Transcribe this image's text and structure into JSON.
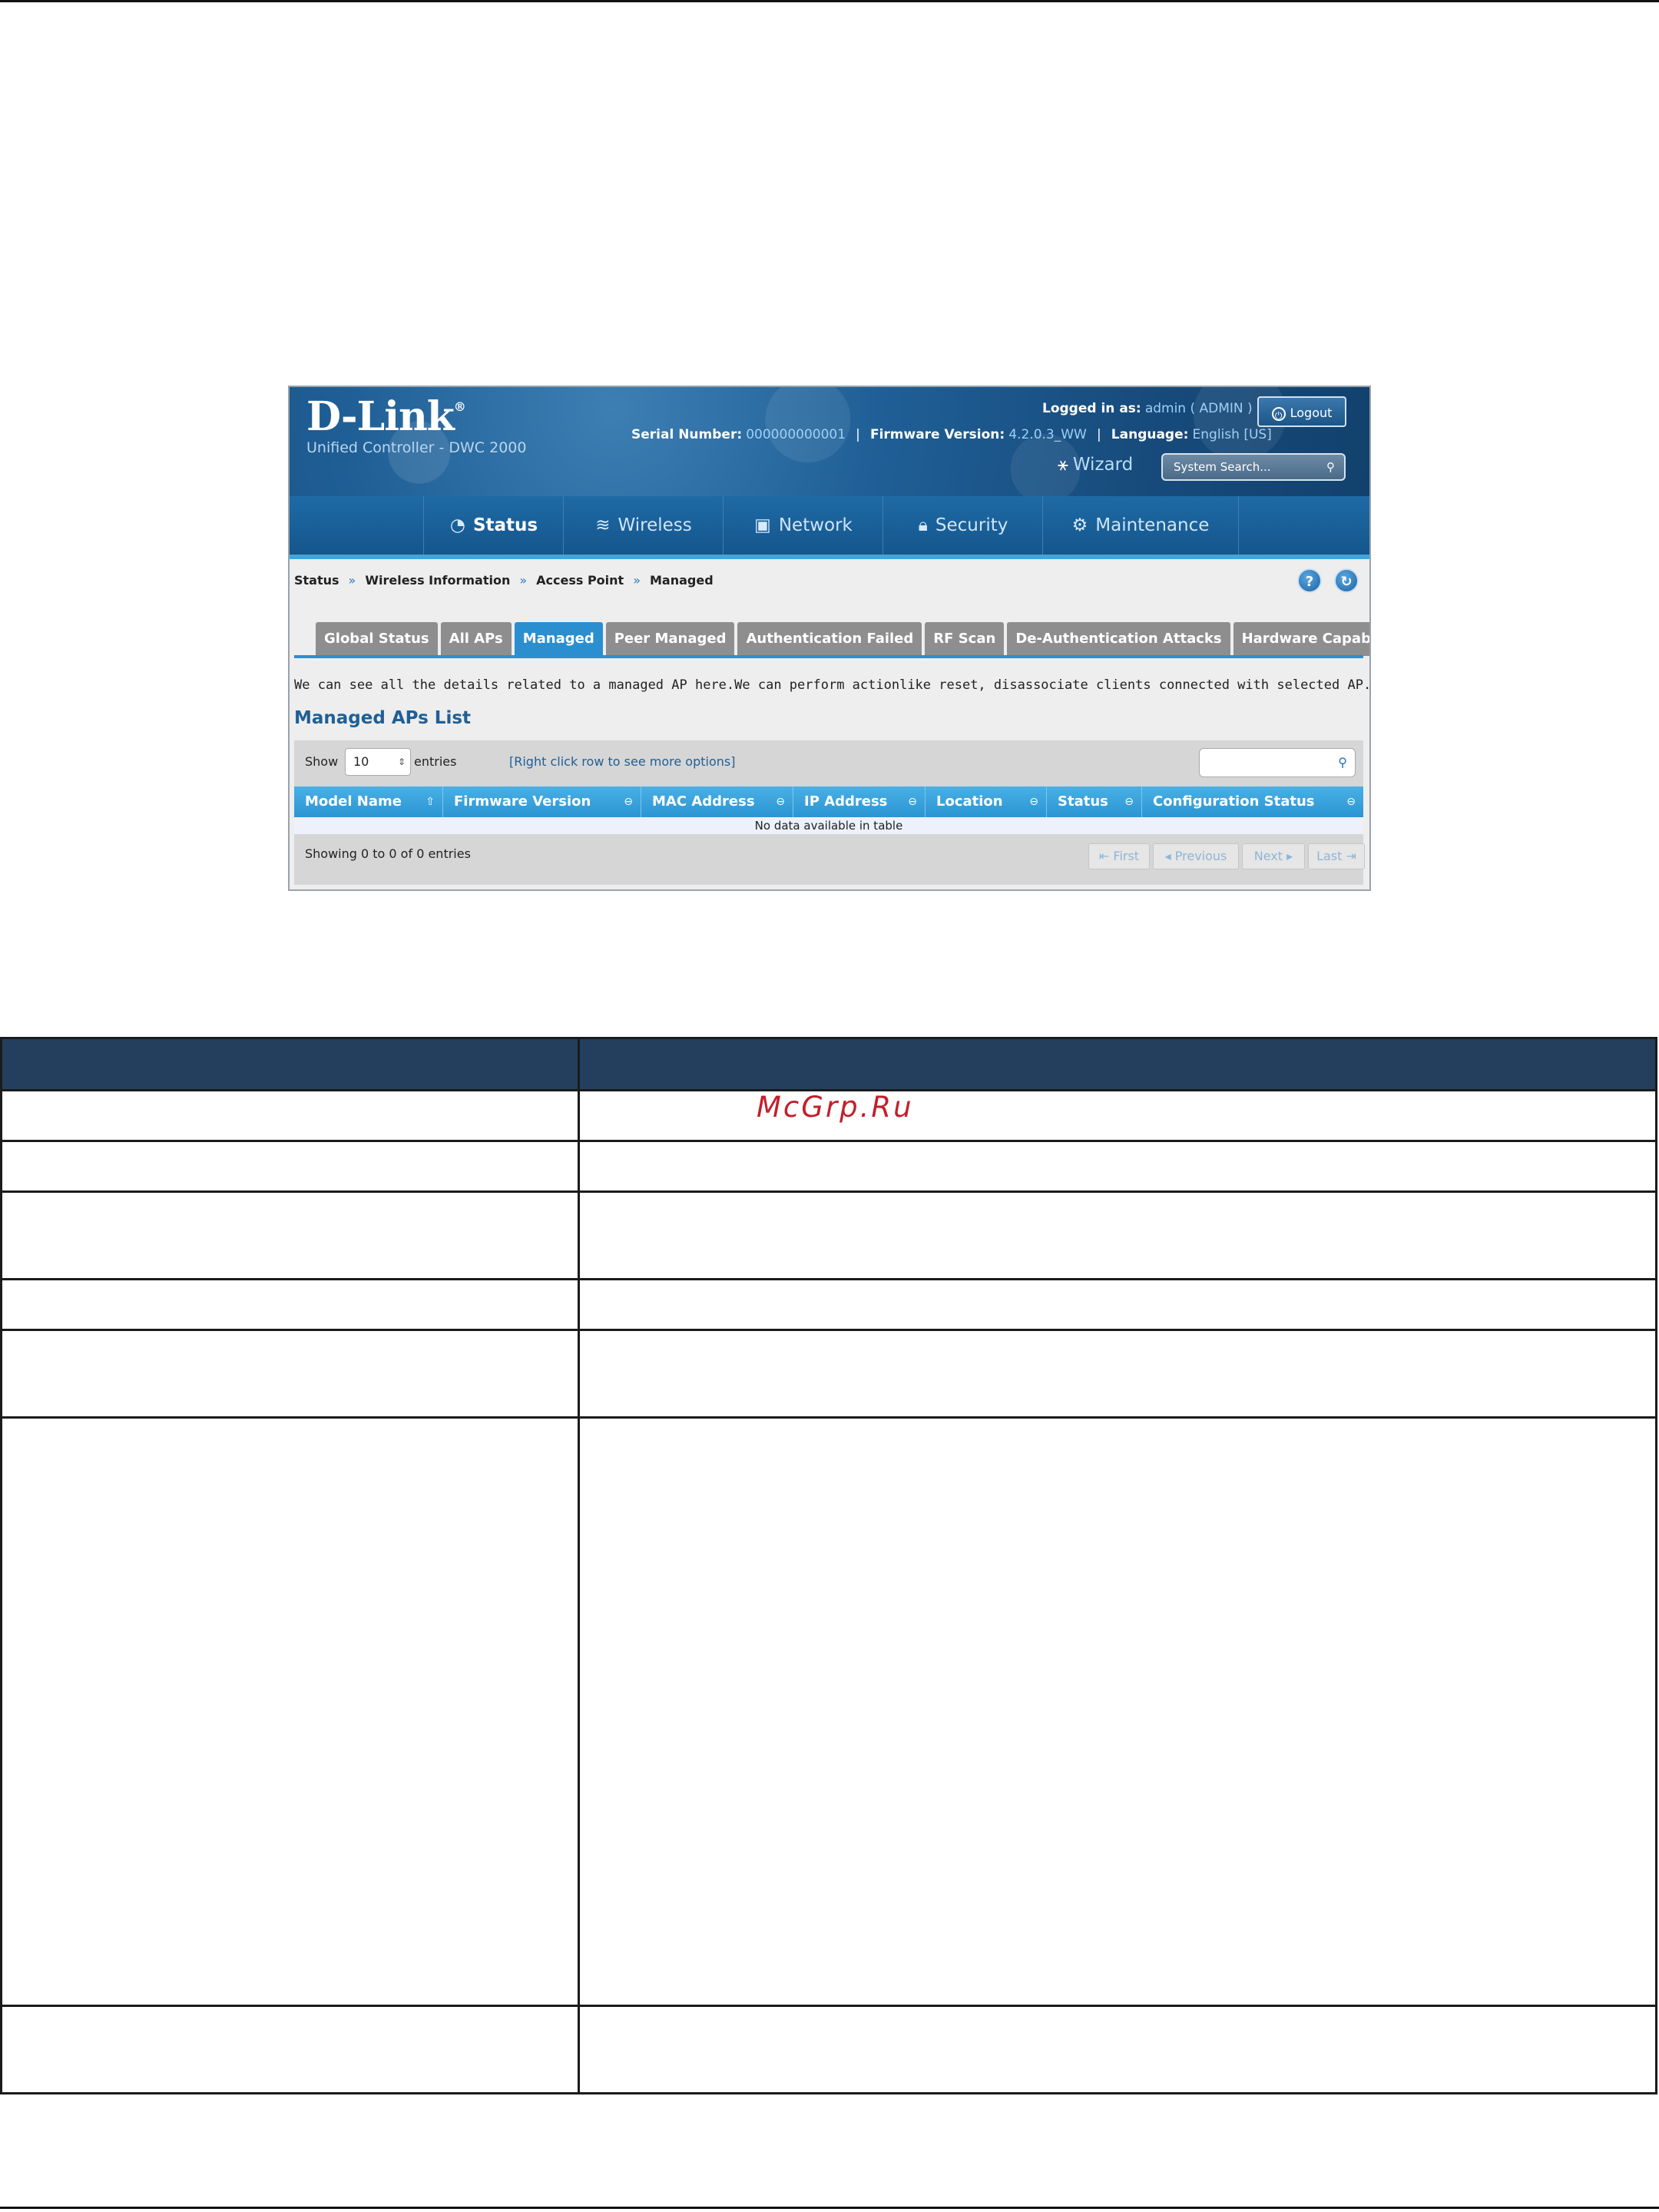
{
  "brand": {
    "logo": "D-Link",
    "logo_mark": "®",
    "product": "Unified Controller - DWC 2000"
  },
  "header": {
    "logged_in_label": "Logged in as:",
    "logged_in_value": "admin ( ADMIN )",
    "logout_label": "Logout",
    "serial_label": "Serial Number:",
    "serial_value": "000000000001",
    "firmware_label": "Firmware Version:",
    "firmware_value": "4.2.0.3_WW",
    "language_label": "Language:",
    "language_value": "English [US]",
    "wizard_label": "Wizard",
    "search_placeholder": "System Search..."
  },
  "nav": {
    "items": [
      {
        "label": "Status",
        "icon": "gauge-icon",
        "active": true
      },
      {
        "label": "Wireless",
        "icon": "wifi-icon"
      },
      {
        "label": "Network",
        "icon": "monitor-icon"
      },
      {
        "label": "Security",
        "icon": "lock-icon"
      },
      {
        "label": "Maintenance",
        "icon": "gears-icon"
      }
    ]
  },
  "breadcrumb": {
    "items": [
      "Status",
      "Wireless Information",
      "Access Point",
      "Managed"
    ],
    "separator": "»"
  },
  "tabs": [
    {
      "label": "Global Status"
    },
    {
      "label": "All APs"
    },
    {
      "label": "Managed",
      "active": true
    },
    {
      "label": "Peer Managed"
    },
    {
      "label": "Authentication Failed"
    },
    {
      "label": "RF Scan"
    },
    {
      "label": "De-Authentication Attacks"
    },
    {
      "label": "Hardware Capability"
    }
  ],
  "page": {
    "description": "We can see all the details related to a managed AP here.We can perform actionlike reset, disassociate clients connected with selected AP.",
    "list_title": "Managed APs List"
  },
  "table": {
    "show_label": "Show",
    "show_value": "10",
    "entries_label": "entries",
    "right_click_hint": "[Right click row to see more options]",
    "columns": [
      "Model Name",
      "Firmware Version",
      "MAC Address",
      "IP Address",
      "Location",
      "Status",
      "Configuration Status"
    ],
    "empty_text": "No data available in table",
    "showing_text": "Showing 0 to 0 of 0 entries",
    "pagination": {
      "first": "First",
      "previous": "Previous",
      "next": "Next",
      "last": "Last"
    }
  },
  "watermark": "McGrp.Ru",
  "colors": {
    "header_blue": "#1f5f96",
    "tab_active": "#2b8fcf",
    "table_header": "#243f5e",
    "watermark": "#c41e2a"
  }
}
